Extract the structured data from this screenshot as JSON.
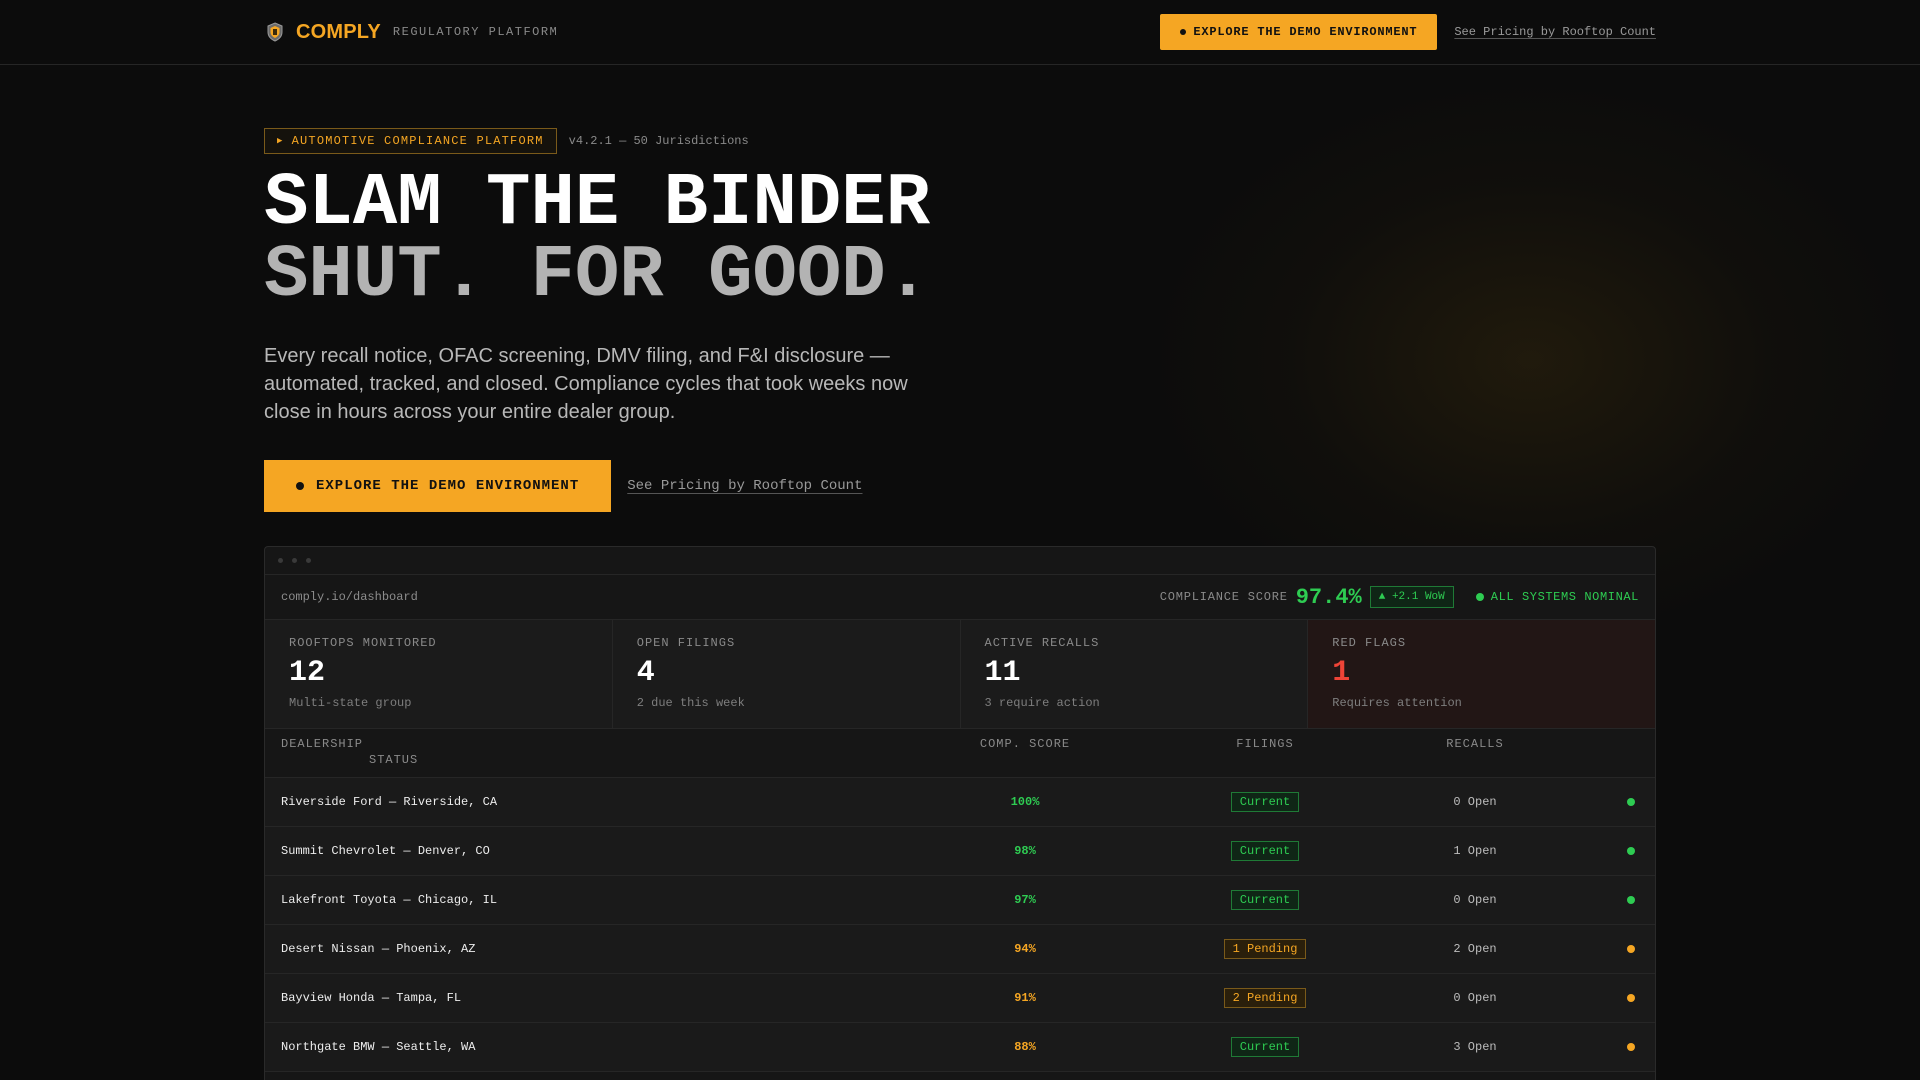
{
  "nav": {
    "brand": "COMPLY",
    "brand_sub": "REGULATORY PLATFORM",
    "cta_label": "EXPLORE THE DEMO ENVIRONMENT",
    "pricing_link": "See Pricing by Rooftop Count"
  },
  "hero": {
    "pill": "AUTOMOTIVE COMPLIANCE PLATFORM",
    "pill_meta": "v4.2.1 — 50 Jurisdictions",
    "headline_1": "SLAM THE BINDER",
    "headline_2": "SHUT. FOR GOOD.",
    "lede": "Every recall notice, OFAC screening, DMV filing, and F&I disclosure — automated, tracked, and closed. Compliance cycles that took weeks now close in hours across your entire dealer group.",
    "cta_label": "EXPLORE THE DEMO ENVIRONMENT",
    "pricing_link": "See Pricing by Rooftop Count"
  },
  "dashboard": {
    "url": "comply.io/dashboard",
    "score_label": "COMPLIANCE SCORE",
    "score_value": "97.4%",
    "score_delta": "▲ +2.1 WoW",
    "systems": "ALL SYSTEMS NOMINAL",
    "stats": [
      {
        "label": "ROOFTOPS MONITORED",
        "value": "12",
        "sub": "Multi-state group"
      },
      {
        "label": "OPEN FILINGS",
        "value": "4",
        "sub": "2 due this week"
      },
      {
        "label": "ACTIVE RECALLS",
        "value": "11",
        "sub": "3 require action"
      },
      {
        "label": "RED FLAGS",
        "value": "1",
        "sub": "Requires attention"
      }
    ],
    "columns": {
      "dealership": "DEALERSHIP",
      "score": "COMP. SCORE",
      "filings": "FILINGS",
      "recalls": "RECALLS",
      "status": "STATUS"
    },
    "rows": [
      {
        "name": "Riverside Ford — Riverside, CA",
        "score": "100%",
        "filings": "Current",
        "recalls": "0 Open"
      },
      {
        "name": "Summit Chevrolet — Denver, CO",
        "score": "98%",
        "filings": "Current",
        "recalls": "1 Open"
      },
      {
        "name": "Lakefront Toyota — Chicago, IL",
        "score": "97%",
        "filings": "Current",
        "recalls": "0 Open"
      },
      {
        "name": "Desert Nissan — Phoenix, AZ",
        "score": "94%",
        "filings": "1 Pending",
        "recalls": "2 Open"
      },
      {
        "name": "Bayview Honda — Tampa, FL",
        "score": "91%",
        "filings": "2 Pending",
        "recalls": "0 Open"
      },
      {
        "name": "Northgate BMW — Seattle, WA",
        "score": "88%",
        "filings": "Current",
        "recalls": "3 Open"
      }
    ]
  },
  "colors": {
    "accent": "#f5a623",
    "ok": "#2ecc52",
    "alert": "#ef4437",
    "bg": "#0c0c0c"
  }
}
